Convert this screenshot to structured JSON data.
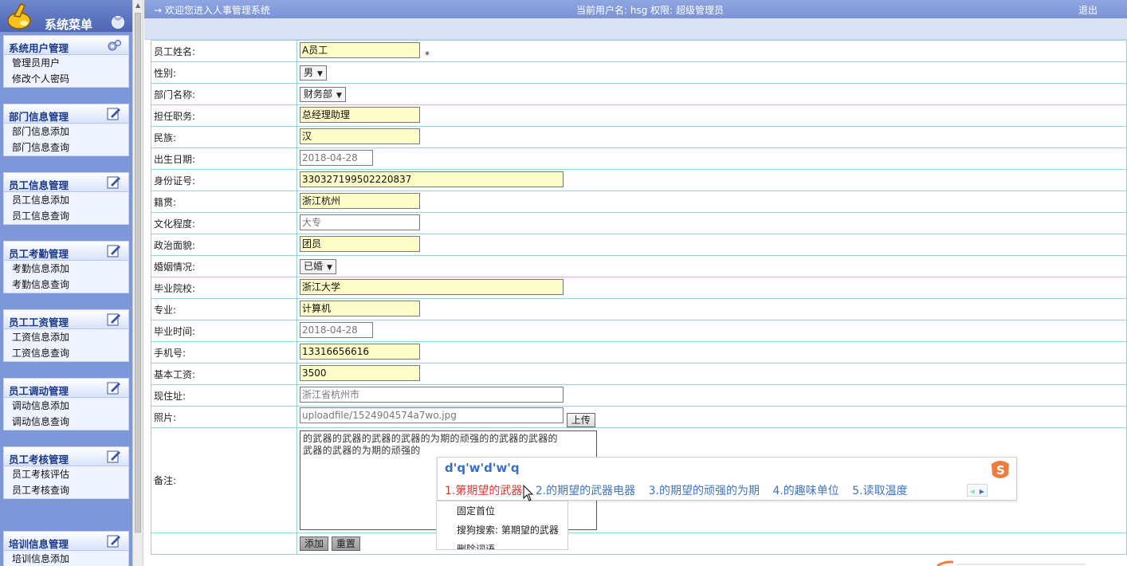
{
  "menu": {
    "title": "系统菜单",
    "collapse_icon": "double-chevron-down-icon",
    "groups": [
      {
        "title": "系统用户管理",
        "icon": "gears-icon",
        "items": [
          "管理员用户",
          "修改个人密码"
        ]
      },
      {
        "title": "部门信息管理",
        "icon": "edit-icon",
        "items": [
          "部门信息添加",
          "部门信息查询"
        ]
      },
      {
        "title": "员工信息管理",
        "icon": "edit-icon",
        "items": [
          "员工信息添加",
          "员工信息查询"
        ]
      },
      {
        "title": "员工考勤管理",
        "icon": "edit-icon",
        "items": [
          "考勤信息添加",
          "考勤信息查询"
        ]
      },
      {
        "title": "员工工资管理",
        "icon": "edit-icon",
        "items": [
          "工资信息添加",
          "工资信息查询"
        ]
      },
      {
        "title": "员工调动管理",
        "icon": "edit-icon",
        "items": [
          "调动信息添加",
          "调动信息查询"
        ]
      },
      {
        "title": "员工考核管理",
        "icon": "edit-icon",
        "items": [
          "员工考核评估",
          "员工考核查询"
        ]
      },
      {
        "title": "培训信息管理",
        "icon": "edit-icon",
        "items": [
          "培训信息添加"
        ]
      }
    ]
  },
  "topbar": {
    "welcome": "→ 欢迎您进入人事管理系统",
    "user": "当前用户名: hsg 权限: 超级管理员",
    "logout": "退出"
  },
  "form": {
    "name_label": "员工姓名:",
    "name_value": "A员工",
    "required_mark": "*",
    "gender_label": "性别:",
    "gender_value": "男",
    "dept_label": "部门名称:",
    "dept_value": "财务部",
    "position_label": "担任职务:",
    "position_value": "总经理助理",
    "ethnic_label": "民族:",
    "ethnic_value": "汉",
    "birth_label": "出生日期:",
    "birth_value": "2018-04-28",
    "idcard_label": "身份证号:",
    "idcard_value": "330327199502220837",
    "native_label": "籍贯:",
    "native_value": "浙江杭州",
    "edu_label": "文化程度:",
    "edu_value": "大专",
    "political_label": "政治面貌:",
    "political_value": "团员",
    "marital_label": "婚姻情况:",
    "marital_value": "已婚",
    "school_label": "毕业院校:",
    "school_value": "浙江大学",
    "major_label": "专业:",
    "major_value": "计算机",
    "grad_label": "毕业时间:",
    "grad_value": "2018-04-28",
    "phone_label": "手机号:",
    "phone_value": "13316656616",
    "salary_label": "基本工资:",
    "salary_value": "3500",
    "address_label": "现住址:",
    "address_value": "浙江省杭州市",
    "photo_label": "照片:",
    "photo_value": "uploadfile/1524904574a7wo.jpg",
    "upload_button": "上传",
    "remark_label": "备注:",
    "remark_line1": "的武器的武器的武器的武器的为期的顽强的的武器的武器的",
    "remark_line2": "武器的武器的为期的顽强的",
    "add_button": "添加",
    "reset_button": "重置"
  },
  "ime": {
    "input": "d'q'w'd'w'q",
    "candidates": [
      "1.第期望的武器",
      "2.的期望的武器电器",
      "3.的期望的顽强的为期",
      "4.的趣味单位",
      "5.读取温度"
    ],
    "menu_items": [
      "固定首位",
      "搜狗搜索: 第期望的武器",
      "删除词语"
    ]
  }
}
